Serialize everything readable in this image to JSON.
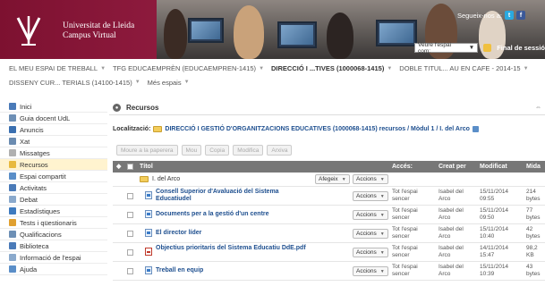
{
  "header": {
    "university": "Universitat de Lleida",
    "subtitle": "Campus Virtual",
    "follow_text": "Segueix-nos a:",
    "twitter": "t",
    "facebook": "f",
    "role_select": "Veure l'espai com:",
    "finalize": "Final de sessió"
  },
  "crumbs_row1": [
    {
      "label": "EL MEU ESPAI DE TREBALL",
      "active": false
    },
    {
      "label": "TFG EDUCAEMPRÈN (EDUCAEMPREN-1415)",
      "active": false
    },
    {
      "label": "DIRECCIÓ I ...TIVES (1000068-1415)",
      "active": true
    },
    {
      "label": "DOBLE TITUL... AU EN CAFE - 2014-15",
      "active": false
    }
  ],
  "crumbs_row2": [
    {
      "label": "DISSENY CUR... TERIALS (14100-1415)"
    },
    {
      "label": "Més espais"
    }
  ],
  "sidebar": {
    "items": [
      {
        "label": "Inici",
        "color": "#4a7ab8"
      },
      {
        "label": "Guia docent UdL",
        "color": "#6d8fb5"
      },
      {
        "label": "Anuncis",
        "color": "#3a6fb0"
      },
      {
        "label": "Xat",
        "color": "#6a8bb0"
      },
      {
        "label": "Missatges",
        "color": "#b0b0b0"
      },
      {
        "label": "Recursos",
        "color": "#e8b93c"
      },
      {
        "label": "Espai compartit",
        "color": "#5a8ec8"
      },
      {
        "label": "Activitats",
        "color": "#4a7ab8"
      },
      {
        "label": "Debat",
        "color": "#8aa9cc"
      },
      {
        "label": "Estadístiques",
        "color": "#3d7abf"
      },
      {
        "label": "Tests i qüestionaris",
        "color": "#e0a030"
      },
      {
        "label": "Qualificacions",
        "color": "#6d8fb5"
      },
      {
        "label": "Biblioteca",
        "color": "#4a7ab8"
      },
      {
        "label": "Informació de l'espai",
        "color": "#8aa9cc"
      },
      {
        "label": "Ajuda",
        "color": "#5a8ec8"
      }
    ],
    "active_index": 5
  },
  "main": {
    "title": "Recursos",
    "location_label": "Localització:",
    "location_path": "DIRECCIÓ I GESTIÓ D'ORGANITZACIONS EDUCATIVES (1000068-1415) recursos / Mòdul 1 / I. del Arco",
    "toolbar": [
      "Moure a la paperera",
      "Mou",
      "Copia",
      "Modifica",
      "Arxiva"
    ],
    "columns": {
      "title": "Títol",
      "access": "Accés:",
      "created_by": "Creat per",
      "modified": "Modificat",
      "size": "Mida"
    },
    "folder_row": {
      "name": "I. del Arco",
      "add_label": "Afegeix",
      "actions_label": "Accions"
    },
    "rows": [
      {
        "name": "Consell Superior d'Avaluació del Sistema Educatiudel",
        "type": "doc",
        "actions": "Accions",
        "access": "Tot l'espai sencer",
        "creator": "Isabel del Arco",
        "modified": "15/11/2014 09:55",
        "size": "214 bytes"
      },
      {
        "name": "Documents per a la gestió d'un centre",
        "type": "doc",
        "actions": "Accions",
        "access": "Tot l'espai sencer",
        "creator": "Isabel del Arco",
        "modified": "15/11/2014 09:50",
        "size": "77 bytes"
      },
      {
        "name": "El director líder",
        "type": "doc",
        "actions": "Accions",
        "access": "Tot l'espai sencer",
        "creator": "Isabel del Arco",
        "modified": "15/11/2014 10:40",
        "size": "42 bytes"
      },
      {
        "name": "Objectius prioritaris del Sistema Educatiu DdE.pdf",
        "type": "pdf",
        "actions": "Accions",
        "access": "Tot l'espai sencer",
        "creator": "Isabel del Arco",
        "modified": "14/11/2014 15:47",
        "size": "98,2 KB"
      },
      {
        "name": "Treball en equip",
        "type": "doc",
        "actions": "Accions",
        "access": "Tot l'espai sencer",
        "creator": "Isabel del Arco",
        "modified": "15/11/2014 10:39",
        "size": "43 bytes"
      }
    ]
  }
}
